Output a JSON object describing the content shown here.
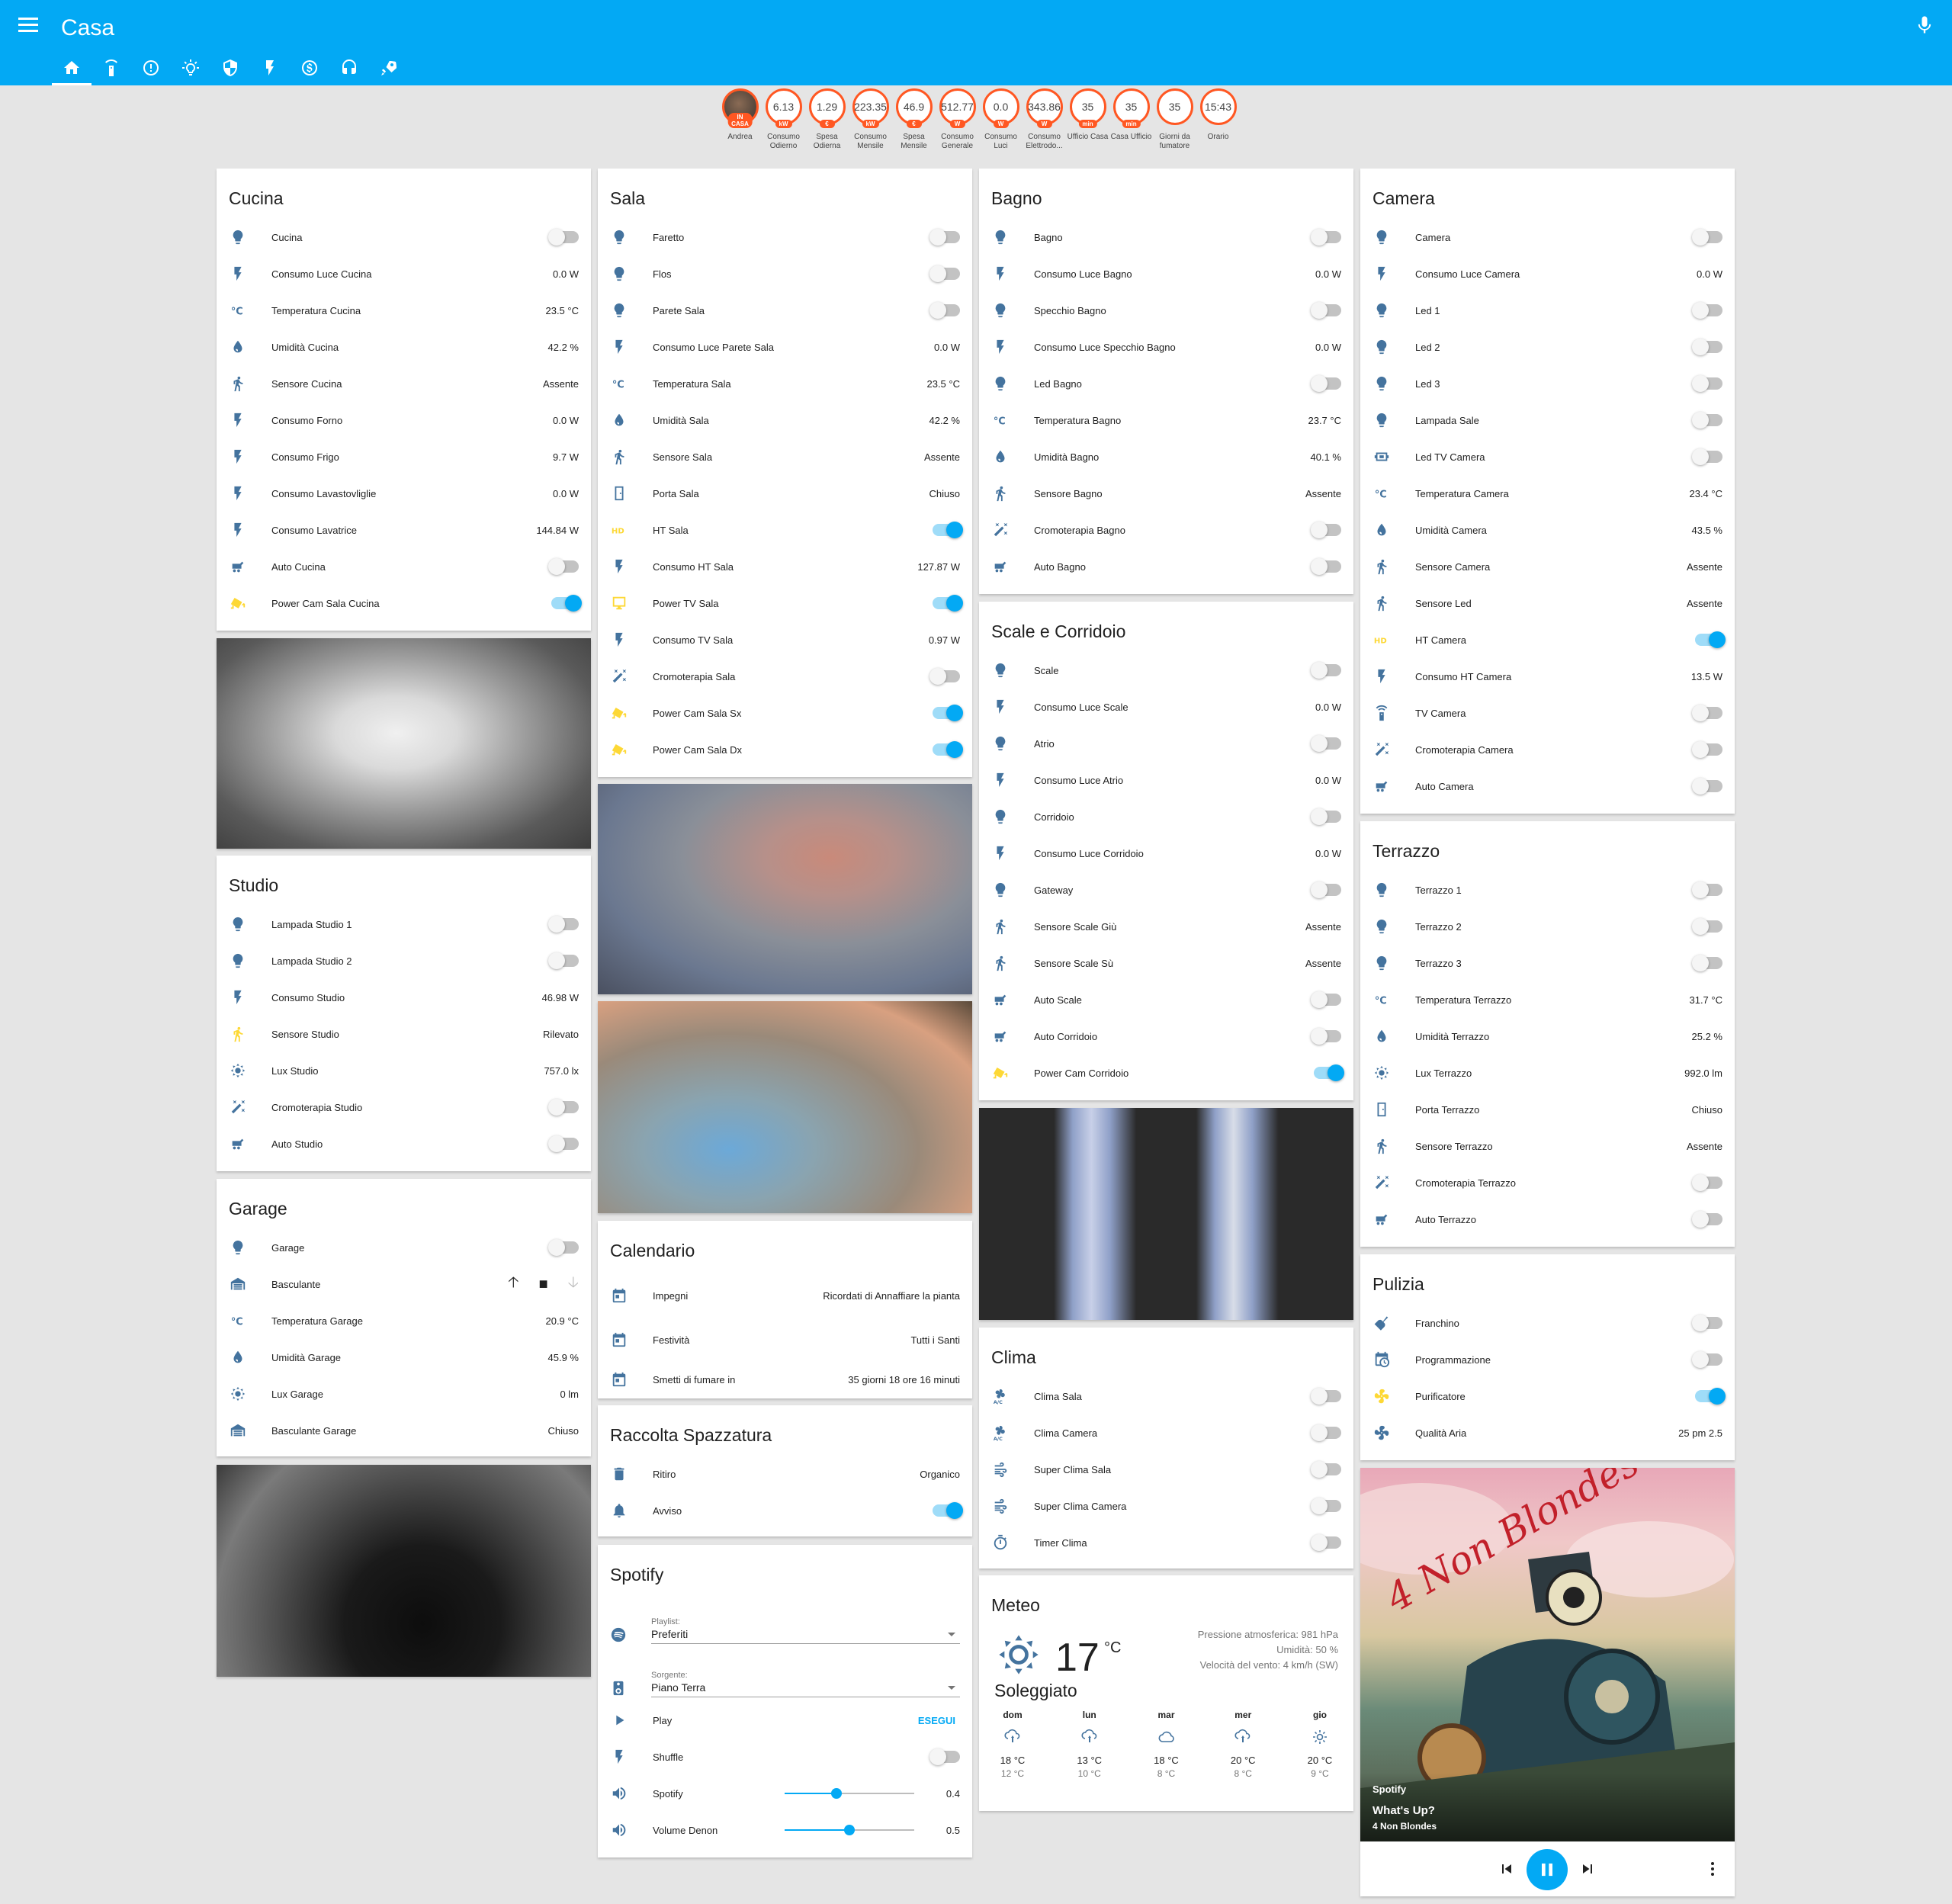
{
  "header": {
    "title": "Casa",
    "menu_icon": "menu-icon",
    "mic_icon": "microphone-icon"
  },
  "tabs": [
    "home-icon",
    "remote-icon",
    "info-icon",
    "lightbulb-icon",
    "shield-icon",
    "flash-icon",
    "money-icon",
    "headphones-icon",
    "rocket-icon"
  ],
  "badges": [
    {
      "value": "",
      "unit": "IN CASA",
      "label": "Andrea"
    },
    {
      "value": "6.13",
      "unit": "kW",
      "label": "Consumo Odierno"
    },
    {
      "value": "1.29",
      "unit": "€",
      "label": "Spesa Odierna"
    },
    {
      "value": "223.35",
      "unit": "kW",
      "label": "Consumo Mensile"
    },
    {
      "value": "46.9",
      "unit": "€",
      "label": "Spesa Mensile"
    },
    {
      "value": "512.77",
      "unit": "W",
      "label": "Consumo Generale"
    },
    {
      "value": "0.0",
      "unit": "W",
      "label": "Consumo Luci"
    },
    {
      "value": "343.86",
      "unit": "W",
      "label": "Consumo Elettrodo..."
    },
    {
      "value": "35",
      "unit": "min",
      "label": "Ufficio Casa"
    },
    {
      "value": "35",
      "unit": "min",
      "label": "Casa Ufficio"
    },
    {
      "value": "35",
      "unit": "",
      "label": "Giorni da fumatore"
    },
    {
      "value": "15:43",
      "unit": "",
      "label": "Orario"
    }
  ],
  "colors": {
    "primary": "#03a9f4",
    "icon": "#44739e",
    "active_icon": "#fdd835",
    "badge": "#ff5722"
  },
  "cards": {
    "cucina": {
      "title": "Cucina",
      "rows": [
        {
          "icon": "bulb",
          "name": "Cucina",
          "toggle": false
        },
        {
          "icon": "flash",
          "name": "Consumo Luce Cucina",
          "value": "0.0 W"
        },
        {
          "icon": "temp",
          "name": "Temperatura Cucina",
          "value": "23.5 °C"
        },
        {
          "icon": "drop",
          "name": "Umidità Cucina",
          "value": "42.2 %"
        },
        {
          "icon": "walk",
          "name": "Sensore Cucina",
          "value": "Assente"
        },
        {
          "icon": "flash",
          "name": "Consumo Forno",
          "value": "0.0 W"
        },
        {
          "icon": "flash",
          "name": "Consumo Frigo",
          "value": "9.7 W"
        },
        {
          "icon": "flash",
          "name": "Consumo Lavastovliglie",
          "value": "0.0 W"
        },
        {
          "icon": "flash",
          "name": "Consumo Lavatrice",
          "value": "144.84 W"
        },
        {
          "icon": "robot",
          "name": "Auto Cucina",
          "toggle": false
        },
        {
          "icon": "cctv",
          "name": "Power Cam Sala Cucina",
          "toggle": true,
          "active": true
        }
      ]
    },
    "studio": {
      "title": "Studio",
      "rows": [
        {
          "icon": "bulb",
          "name": "Lampada Studio 1",
          "toggle": false
        },
        {
          "icon": "bulb",
          "name": "Lampada Studio 2",
          "toggle": false
        },
        {
          "icon": "flash",
          "name": "Consumo Studio",
          "value": "46.98 W"
        },
        {
          "icon": "run",
          "name": "Sensore Studio",
          "value": "Rilevato",
          "active": true
        },
        {
          "icon": "sun",
          "name": "Lux Studio",
          "value": "757.0 lx"
        },
        {
          "icon": "wand",
          "name": "Cromoterapia Studio",
          "toggle": false
        },
        {
          "icon": "robot",
          "name": "Auto Studio",
          "toggle": false
        }
      ]
    },
    "garage": {
      "title": "Garage",
      "rows": [
        {
          "icon": "bulb",
          "name": "Garage",
          "toggle": false
        },
        {
          "icon": "garage",
          "name": "Basculante",
          "cover": true
        },
        {
          "icon": "temp",
          "name": "Temperatura Garage",
          "value": "20.9 °C"
        },
        {
          "icon": "drop",
          "name": "Umidità Garage",
          "value": "45.9 %"
        },
        {
          "icon": "sun",
          "name": "Lux Garage",
          "value": "0 lm"
        },
        {
          "icon": "garage",
          "name": "Basculante Garage",
          "value": "Chiuso"
        }
      ]
    },
    "sala": {
      "title": "Sala",
      "rows": [
        {
          "icon": "bulb",
          "name": "Faretto",
          "toggle": false
        },
        {
          "icon": "bulb",
          "name": "Flos",
          "toggle": false
        },
        {
          "icon": "bulb",
          "name": "Parete Sala",
          "toggle": false
        },
        {
          "icon": "flash",
          "name": "Consumo Luce Parete Sala",
          "value": "0.0 W"
        },
        {
          "icon": "temp",
          "name": "Temperatura Sala",
          "value": "23.5 °C"
        },
        {
          "icon": "drop",
          "name": "Umidità Sala",
          "value": "42.2 %"
        },
        {
          "icon": "walk",
          "name": "Sensore Sala",
          "value": "Assente"
        },
        {
          "icon": "door",
          "name": "Porta Sala",
          "value": "Chiuso"
        },
        {
          "icon": "hd",
          "name": "HT Sala",
          "toggle": true,
          "active": true
        },
        {
          "icon": "flash",
          "name": "Consumo HT Sala",
          "value": "127.87 W"
        },
        {
          "icon": "tv",
          "name": "Power TV Sala",
          "toggle": true,
          "active": true
        },
        {
          "icon": "flash",
          "name": "Consumo TV Sala",
          "value": "0.97 W"
        },
        {
          "icon": "wand",
          "name": "Cromoterapia Sala",
          "toggle": false
        },
        {
          "icon": "cctv",
          "name": "Power Cam Sala Sx",
          "toggle": true,
          "active": true
        },
        {
          "icon": "cctv",
          "name": "Power Cam Sala Dx",
          "toggle": true,
          "active": true
        }
      ]
    },
    "calendario": {
      "title": "Calendario",
      "rows": [
        {
          "icon": "calendar",
          "name": "Impegni",
          "value": "Ricordati di Annaffiare la pianta"
        },
        {
          "icon": "calendar",
          "name": "Festività",
          "value": "Tutti i Santi"
        },
        {
          "icon": "calendar",
          "name": "Smetti di fumare in",
          "value": "35 giorni 18 ore 16 minuti"
        }
      ]
    },
    "spazzatura": {
      "title": "Raccolta Spazzatura",
      "rows": [
        {
          "icon": "trash",
          "name": "Ritiro",
          "value": "Organico"
        },
        {
          "icon": "bell",
          "name": "Avviso",
          "toggle": true
        }
      ]
    },
    "spotify": {
      "title": "Spotify",
      "playlist_label": "Playlist:",
      "playlist_value": "Preferiti",
      "source_label": "Sorgente:",
      "source_value": "Piano Terra",
      "play_label": "Play",
      "run_label": "ESEGUI",
      "shuffle_label": "Shuffle",
      "volumes": [
        {
          "name": "Spotify",
          "value": "0.4",
          "level": 0.4
        },
        {
          "name": "Volume Denon",
          "value": "0.5",
          "level": 0.5
        }
      ]
    },
    "bagno": {
      "title": "Bagno",
      "rows": [
        {
          "icon": "bulb",
          "name": "Bagno",
          "toggle": false
        },
        {
          "icon": "flash",
          "name": "Consumo Luce Bagno",
          "value": "0.0 W"
        },
        {
          "icon": "bulb",
          "name": "Specchio Bagno",
          "toggle": false
        },
        {
          "icon": "flash",
          "name": "Consumo Luce Specchio Bagno",
          "value": "0.0 W"
        },
        {
          "icon": "bulb",
          "name": "Led Bagno",
          "toggle": false
        },
        {
          "icon": "temp",
          "name": "Temperatura Bagno",
          "value": "23.7 °C"
        },
        {
          "icon": "drop",
          "name": "Umidità Bagno",
          "value": "40.1 %"
        },
        {
          "icon": "walk",
          "name": "Sensore Bagno",
          "value": "Assente"
        },
        {
          "icon": "wand",
          "name": "Cromoterapia Bagno",
          "toggle": false
        },
        {
          "icon": "robot",
          "name": "Auto Bagno",
          "toggle": false
        }
      ]
    },
    "scale": {
      "title": "Scale e Corridoio",
      "rows": [
        {
          "icon": "bulb",
          "name": "Scale",
          "toggle": false
        },
        {
          "icon": "flash",
          "name": "Consumo Luce Scale",
          "value": "0.0 W"
        },
        {
          "icon": "bulb",
          "name": "Atrio",
          "toggle": false
        },
        {
          "icon": "flash",
          "name": "Consumo Luce Atrio",
          "value": "0.0 W"
        },
        {
          "icon": "bulb",
          "name": "Corridoio",
          "toggle": false
        },
        {
          "icon": "flash",
          "name": "Consumo Luce Corridoio",
          "value": "0.0 W"
        },
        {
          "icon": "bulb",
          "name": "Gateway",
          "toggle": false
        },
        {
          "icon": "walk",
          "name": "Sensore Scale Giù",
          "value": "Assente"
        },
        {
          "icon": "walk",
          "name": "Sensore Scale Sù",
          "value": "Assente"
        },
        {
          "icon": "robot",
          "name": "Auto Scale",
          "toggle": false
        },
        {
          "icon": "robot",
          "name": "Auto Corridoio",
          "toggle": false
        },
        {
          "icon": "cctv",
          "name": "Power Cam Corridoio",
          "toggle": true,
          "active": true
        }
      ]
    },
    "clima": {
      "title": "Clima",
      "rows": [
        {
          "icon": "ac",
          "name": "Clima Sala",
          "toggle": false
        },
        {
          "icon": "ac",
          "name": "Clima Camera",
          "toggle": false
        },
        {
          "icon": "wind",
          "name": "Super Clima Sala",
          "toggle": false
        },
        {
          "icon": "wind",
          "name": "Super Clima Camera",
          "toggle": false
        },
        {
          "icon": "timer",
          "name": "Timer Clima",
          "toggle": false
        }
      ]
    },
    "meteo": {
      "title": "Meteo",
      "temp": "17",
      "unit": "°C",
      "condition": "Soleggiato",
      "details": [
        "Pressione atmosferica: 981 hPa",
        "Umidità: 50 %",
        "Velocità del vento: 4 km/h (SW)"
      ],
      "forecast": [
        {
          "day": "dom",
          "icon": "rain-icon",
          "high": "18 °C",
          "low": "12 °C"
        },
        {
          "day": "lun",
          "icon": "rain-icon",
          "high": "13 °C",
          "low": "10 °C"
        },
        {
          "day": "mar",
          "icon": "cloud-icon",
          "high": "18 °C",
          "low": "8 °C"
        },
        {
          "day": "mer",
          "icon": "rain-icon",
          "high": "20 °C",
          "low": "8 °C"
        },
        {
          "day": "gio",
          "icon": "sun-icon",
          "high": "20 °C",
          "low": "9 °C"
        }
      ]
    },
    "camera": {
      "title": "Camera",
      "rows": [
        {
          "icon": "bulb",
          "name": "Camera",
          "toggle": false
        },
        {
          "icon": "flash",
          "name": "Consumo Luce Camera",
          "value": "0.0 W"
        },
        {
          "icon": "bulb",
          "name": "Led 1",
          "toggle": false
        },
        {
          "icon": "bulb",
          "name": "Led 2",
          "toggle": false
        },
        {
          "icon": "bulb",
          "name": "Led 3",
          "toggle": false
        },
        {
          "icon": "bulb",
          "name": "Lampada Sale",
          "toggle": false
        },
        {
          "icon": "led",
          "name": "Led TV Camera",
          "toggle": false
        },
        {
          "icon": "temp",
          "name": "Temperatura Camera",
          "value": "23.4 °C"
        },
        {
          "icon": "drop",
          "name": "Umidità Camera",
          "value": "43.5 %"
        },
        {
          "icon": "walk",
          "name": "Sensore Camera",
          "value": "Assente"
        },
        {
          "icon": "walk",
          "name": "Sensore Led",
          "value": "Assente"
        },
        {
          "icon": "hd",
          "name": "HT Camera",
          "toggle": true,
          "active": true
        },
        {
          "icon": "flash",
          "name": "Consumo HT Camera",
          "value": "13.5 W"
        },
        {
          "icon": "remote",
          "name": "TV Camera",
          "toggle": false
        },
        {
          "icon": "wand",
          "name": "Cromoterapia Camera",
          "toggle": false
        },
        {
          "icon": "robot",
          "name": "Auto Camera",
          "toggle": false
        }
      ]
    },
    "terrazzo": {
      "title": "Terrazzo",
      "rows": [
        {
          "icon": "bulb",
          "name": "Terrazzo 1",
          "toggle": false
        },
        {
          "icon": "bulb",
          "name": "Terrazzo 2",
          "toggle": false
        },
        {
          "icon": "bulb",
          "name": "Terrazzo 3",
          "toggle": false
        },
        {
          "icon": "temp",
          "name": "Temperatura Terrazzo",
          "value": "31.7 °C"
        },
        {
          "icon": "drop",
          "name": "Umidità Terrazzo",
          "value": "25.2 %"
        },
        {
          "icon": "sun",
          "name": "Lux Terrazzo",
          "value": "992.0 lm"
        },
        {
          "icon": "door",
          "name": "Porta Terrazzo",
          "value": "Chiuso"
        },
        {
          "icon": "walk",
          "name": "Sensore Terrazzo",
          "value": "Assente"
        },
        {
          "icon": "wand",
          "name": "Cromoterapia Terrazzo",
          "toggle": false
        },
        {
          "icon": "robot",
          "name": "Auto Terrazzo",
          "toggle": false
        }
      ]
    },
    "pulizia": {
      "title": "Pulizia",
      "rows": [
        {
          "icon": "broom",
          "name": "Franchino",
          "toggle": false
        },
        {
          "icon": "calclock",
          "name": "Programmazione",
          "toggle": false
        },
        {
          "icon": "fan",
          "name": "Purificatore",
          "toggle": true,
          "active": true
        },
        {
          "icon": "fan",
          "name": "Qualità Aria",
          "value": "25 pm 2.5"
        }
      ]
    }
  },
  "media": {
    "source": "Spotify",
    "track": "What's Up?",
    "artist": "4 Non Blondes",
    "album_art_text": "4 Non Blondes"
  }
}
